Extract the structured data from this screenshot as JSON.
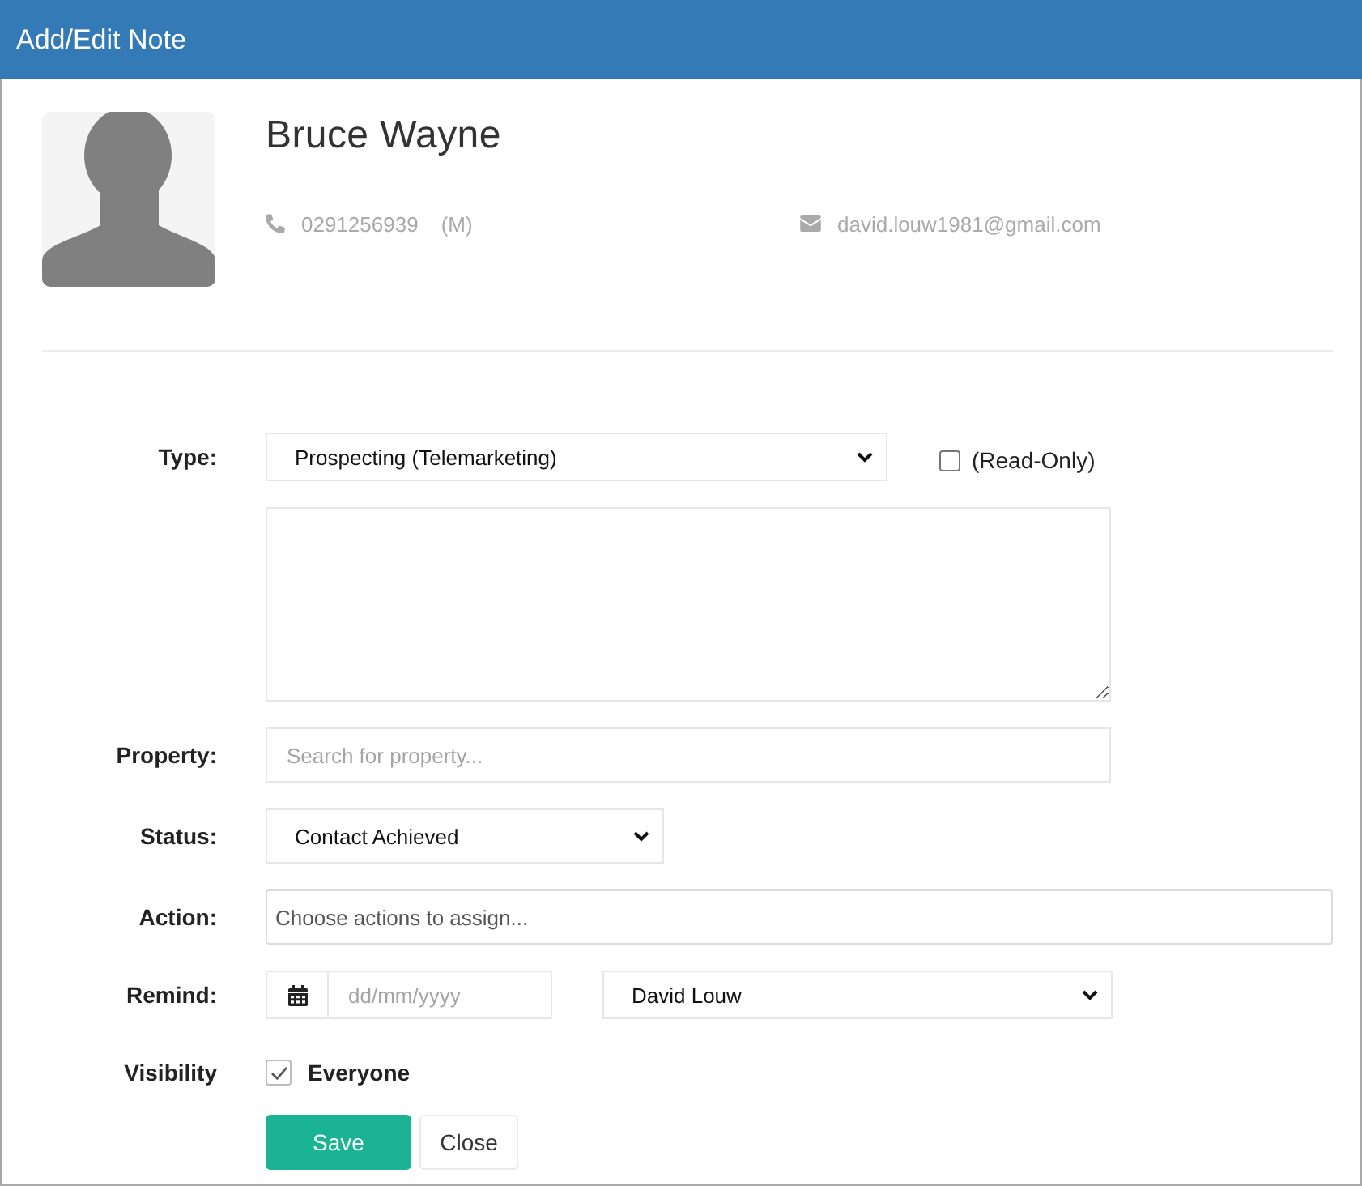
{
  "window": {
    "title": "Add/Edit Note"
  },
  "contact": {
    "name": "Bruce Wayne",
    "phone": "0291256939",
    "phone_type": "(M)",
    "email": "david.louw1981@gmail.com"
  },
  "type_field": {
    "label": "Type:",
    "value": "Prospecting (Telemarketing)"
  },
  "read_only": {
    "label": "(Read-Only)",
    "checked": false
  },
  "property_field": {
    "label": "Property:",
    "placeholder": "Search for property..."
  },
  "status_field": {
    "label": "Status:",
    "value": "Contact Achieved"
  },
  "action_field": {
    "label": "Action:",
    "placeholder": "Choose actions to assign..."
  },
  "remind": {
    "label": "Remind:",
    "date_placeholder": "dd/mm/yyyy",
    "assignee": "David Louw"
  },
  "visibility": {
    "label": "Visibility",
    "option": "Everyone",
    "checked": true
  },
  "buttons": [
    {
      "label": "Save",
      "kind": "primary"
    },
    {
      "label": "Close",
      "kind": "default"
    }
  ]
}
